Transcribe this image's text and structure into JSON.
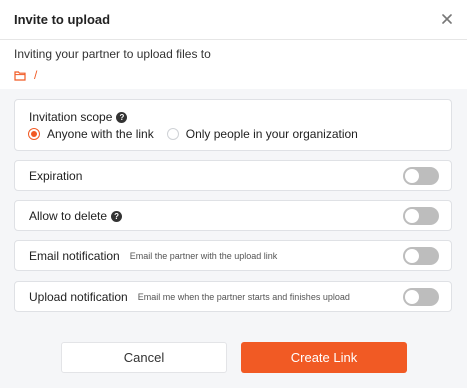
{
  "dialog": {
    "title": "Invite to upload",
    "intro": "Inviting your partner to upload files to",
    "path": "/"
  },
  "scope": {
    "label": "Invitation scope",
    "options": [
      {
        "label": "Anyone with the link",
        "selected": true
      },
      {
        "label": "Only people in your organization",
        "selected": false
      }
    ]
  },
  "settings": {
    "expiration": {
      "label": "Expiration",
      "enabled": false
    },
    "allow_delete": {
      "label": "Allow to delete",
      "enabled": false
    },
    "email_notification": {
      "label": "Email notification",
      "hint": "Email the partner with the upload link",
      "enabled": false
    },
    "upload_notification": {
      "label": "Upload notification",
      "hint": "Email me when the partner starts and finishes upload",
      "enabled": false
    }
  },
  "actions": {
    "cancel": "Cancel",
    "create": "Create Link"
  },
  "colors": {
    "accent": "#f15a24",
    "toggle_off": "#bdbdbd",
    "panel_bg": "#f5f6f8"
  },
  "icons": [
    "close-icon",
    "folder-icon",
    "help-icon"
  ]
}
